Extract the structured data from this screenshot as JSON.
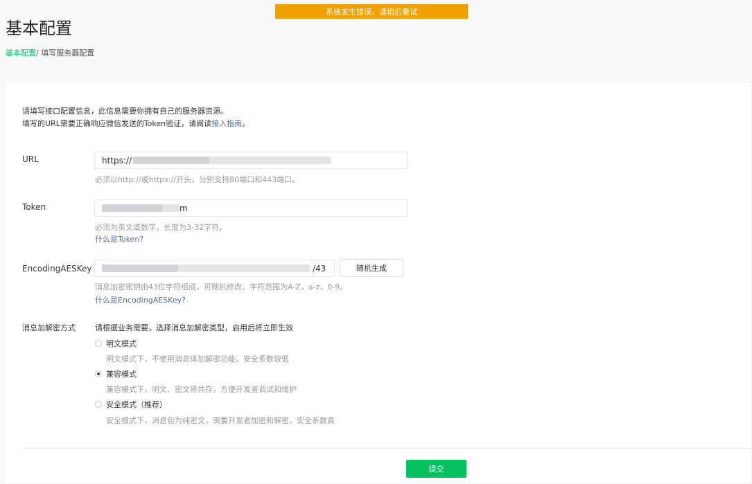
{
  "banner": {
    "error_text": "系统发生错误，请稍后重试"
  },
  "header": {
    "title": "基本配置",
    "breadcrumb": {
      "active": "基本配置",
      "separator": "/",
      "current": " 填写服务器配置"
    }
  },
  "intro": {
    "line1": "请填写接口配置信息，此信息需要你拥有自己的服务器资源。",
    "line2_prefix": "填写的URL需要正确响应微信发送的Token验证，请阅读",
    "line2_link": "接入指南",
    "line2_suffix": "。"
  },
  "fields": {
    "url": {
      "label": "URL",
      "value_visible": "https://",
      "hint": "必须以http://或https://开头，分别支持80端口和443端口。"
    },
    "token": {
      "label": "Token",
      "value_visible": "m",
      "hint": "必须为英文或数字，长度为3-32字符。",
      "help_link": "什么是Token?"
    },
    "aeskey": {
      "label": "EncodingAESKey",
      "value_visible": "/43",
      "random_button": "随机生成",
      "hint": "消息加密密钥由43位字符组成，可随机修改，字符范围为A-Z，a-z，0-9。",
      "help_link": "什么是EncodingAESKey?"
    }
  },
  "encryption": {
    "label": "消息加解密方式",
    "description": "请根据业务需要，选择消息加解密类型，启用后将立即生效",
    "options": [
      {
        "label": "明文模式",
        "desc": "明文模式下，不使用消息体加解密功能，安全系数较低",
        "checked": false
      },
      {
        "label": "兼容模式",
        "desc": "兼容模式下，明文、密文将共存，方便开发者调试和维护",
        "checked": true
      },
      {
        "label": "安全模式（推荐）",
        "desc": "安全模式下，消息包为纯密文，需要开发者加密和解密，安全系数高",
        "checked": false
      }
    ]
  },
  "actions": {
    "submit": "提交"
  },
  "colors": {
    "accent": "#07c160",
    "banner": "#f0a000",
    "link": "#576b95"
  }
}
